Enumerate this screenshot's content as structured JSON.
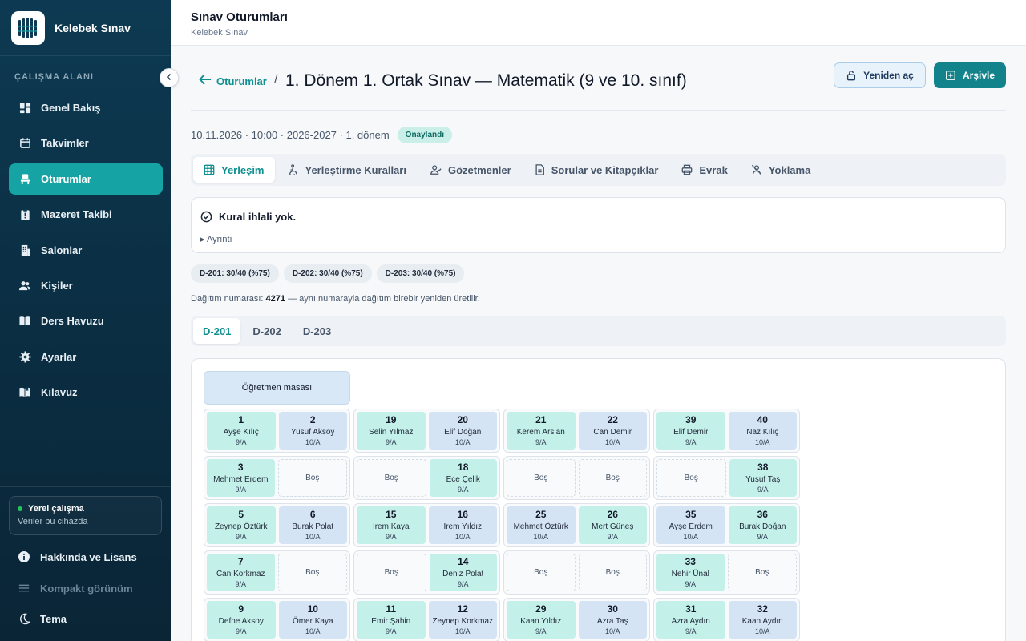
{
  "brand": {
    "name": "Kelebek Sınav"
  },
  "sidebar": {
    "section": "ÇALIŞMA ALANI",
    "items": [
      {
        "label": "Genel Bakış",
        "icon": "dashboard-icon"
      },
      {
        "label": "Takvimler",
        "icon": "calendar-icon"
      },
      {
        "label": "Oturumlar",
        "icon": "seat-icon",
        "active": true
      },
      {
        "label": "Mazeret Takibi",
        "icon": "clipboard-icon"
      },
      {
        "label": "Salonlar",
        "icon": "building-icon"
      },
      {
        "label": "Kişiler",
        "icon": "people-icon"
      },
      {
        "label": "Ders Havuzu",
        "icon": "book-icon"
      },
      {
        "label": "Ayarlar",
        "icon": "gear-icon"
      },
      {
        "label": "Kılavuz",
        "icon": "guide-icon"
      }
    ],
    "local": {
      "title": "Yerel çalışma",
      "subtitle": "Veriler bu cihazda"
    },
    "about": "Hakkında ve Lisans",
    "compact": "Kompakt görünüm",
    "theme": "Tema"
  },
  "header": {
    "title": "Sınav Oturumları",
    "subtitle": "Kelebek Sınav"
  },
  "page": {
    "back_label": "Oturumlar",
    "separator": "/",
    "title": "1. Dönem 1. Ortak Sınav — Matematik (9 ve 10. sınıf)",
    "reopen_label": "Yeniden aç",
    "archive_label": "Arşivle",
    "meta": "10.11.2026 · 10:00 · 2026-2027 · 1. dönem",
    "status": "Onaylandı"
  },
  "tabs": [
    "Yerleşim",
    "Yerleştirme Kuralları",
    "Gözetmenler",
    "Sorular ve Kitapçıklar",
    "Evrak",
    "Yoklama"
  ],
  "rules": {
    "ok": "Kural ihlali yok.",
    "details": "▸ Ayrıntı"
  },
  "chips": [
    "D-201: 30/40 (%75)",
    "D-202: 30/40 (%75)",
    "D-203: 30/40 (%75)"
  ],
  "seed": {
    "prefix": "Dağıtım numarası:",
    "value": "4271",
    "suffix": "— aynı numarayla dağıtım birebir yeniden üretilir."
  },
  "rooms": [
    "D-201",
    "D-202",
    "D-203"
  ],
  "plan": {
    "teacher_desk": "Öğretmen masası",
    "empty_label": "Boş",
    "rows": [
      [
        [
          {
            "no": "1",
            "name": "Ayşe Kılıç",
            "cls": "9/A"
          },
          {
            "no": "2",
            "name": "Yusuf Aksoy",
            "cls": "10/A"
          }
        ],
        [
          {
            "no": "19",
            "name": "Selin Yılmaz",
            "cls": "9/A"
          },
          {
            "no": "20",
            "name": "Elif Doğan",
            "cls": "10/A"
          }
        ],
        [
          {
            "no": "21",
            "name": "Kerem Arslan",
            "cls": "9/A"
          },
          {
            "no": "22",
            "name": "Can Demir",
            "cls": "10/A"
          }
        ],
        [
          {
            "no": "39",
            "name": "Elif Demir",
            "cls": "9/A"
          },
          {
            "no": "40",
            "name": "Naz Kılıç",
            "cls": "10/A"
          }
        ]
      ],
      [
        [
          {
            "no": "3",
            "name": "Mehmet Erdem",
            "cls": "9/A"
          },
          null
        ],
        [
          null,
          {
            "no": "18",
            "name": "Ece Çelik",
            "cls": "9/A"
          }
        ],
        [
          null,
          null
        ],
        [
          null,
          {
            "no": "38",
            "name": "Yusuf Taş",
            "cls": "9/A"
          }
        ]
      ],
      [
        [
          {
            "no": "5",
            "name": "Zeynep Öztürk",
            "cls": "9/A"
          },
          {
            "no": "6",
            "name": "Burak Polat",
            "cls": "10/A"
          }
        ],
        [
          {
            "no": "15",
            "name": "İrem Kaya",
            "cls": "9/A"
          },
          {
            "no": "16",
            "name": "İrem Yıldız",
            "cls": "10/A"
          }
        ],
        [
          {
            "no": "25",
            "name": "Mehmet Öztürk",
            "cls": "10/A"
          },
          {
            "no": "26",
            "name": "Mert Güneş",
            "cls": "9/A"
          }
        ],
        [
          {
            "no": "35",
            "name": "Ayşe Erdem",
            "cls": "10/A"
          },
          {
            "no": "36",
            "name": "Burak Doğan",
            "cls": "9/A"
          }
        ]
      ],
      [
        [
          {
            "no": "7",
            "name": "Can Korkmaz",
            "cls": "9/A"
          },
          null
        ],
        [
          null,
          {
            "no": "14",
            "name": "Deniz Polat",
            "cls": "9/A"
          }
        ],
        [
          null,
          null
        ],
        [
          {
            "no": "33",
            "name": "Nehir Ünal",
            "cls": "9/A"
          },
          null
        ]
      ],
      [
        [
          {
            "no": "9",
            "name": "Defne Aksoy",
            "cls": "9/A"
          },
          {
            "no": "10",
            "name": "Ömer Kaya",
            "cls": "10/A"
          }
        ],
        [
          {
            "no": "11",
            "name": "Emir Şahin",
            "cls": "9/A"
          },
          {
            "no": "12",
            "name": "Zeynep Korkmaz",
            "cls": "10/A"
          }
        ],
        [
          {
            "no": "29",
            "name": "Kaan Yıldız",
            "cls": "9/A"
          },
          {
            "no": "30",
            "name": "Azra Taş",
            "cls": "10/A"
          }
        ],
        [
          {
            "no": "31",
            "name": "Azra Aydın",
            "cls": "9/A"
          },
          {
            "no": "32",
            "name": "Kaan Aydın",
            "cls": "10/A"
          }
        ]
      ]
    ]
  },
  "colors": {
    "accent": "#16a3a3",
    "sidebar": "#0b2f44",
    "seat_9": "#c4f0ea",
    "seat_10": "#d5e4f4"
  }
}
